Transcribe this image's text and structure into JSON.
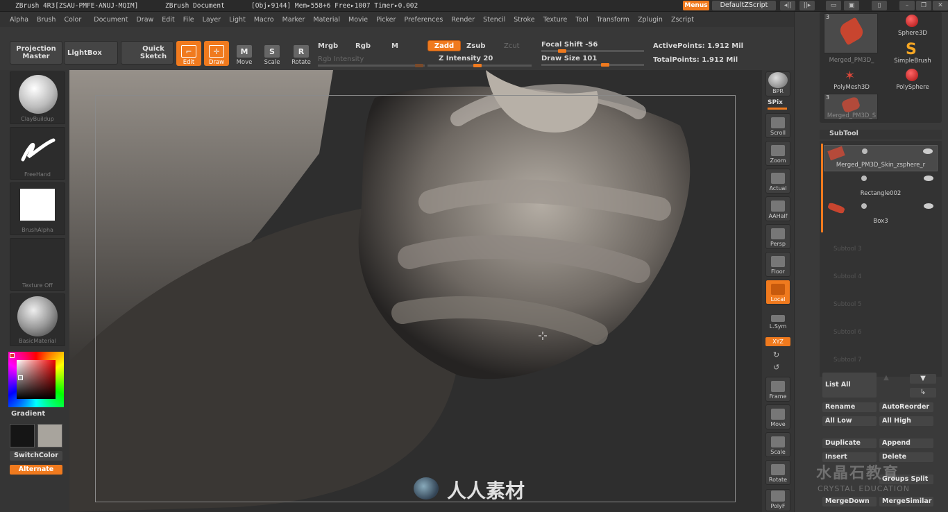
{
  "titlebar": {
    "app": "ZBrush  4R3[ZSAU-PMFE-ANUJ-MQIM]",
    "document": "ZBrush Document",
    "stats": "[Obj▸9144] Mem▸558+6 Free▸1007 Timer▸0.002",
    "menus_label": "Menus",
    "script_label": "DefaultZScript"
  },
  "menubar": {
    "items": [
      "Alpha",
      "Brush",
      "Color",
      "Document",
      "Draw",
      "Edit",
      "File",
      "Layer",
      "Light",
      "Macro",
      "Marker",
      "Material",
      "Movie",
      "Picker",
      "Preferences",
      "Render",
      "Stencil",
      "Stroke",
      "Texture",
      "Tool",
      "Transform",
      "Zplugin",
      "Zscript"
    ]
  },
  "toolbar": {
    "projection_master": "Projection Master",
    "lightbox": "LightBox",
    "quick_sketch": "Quick Sketch",
    "edit": "Edit",
    "draw": "Draw",
    "move": "Move",
    "scale": "Scale",
    "rotate": "Rotate",
    "mrgb": "Mrgb",
    "rgb": "Rgb",
    "m": "M",
    "rgb_intensity": "Rgb Intensity",
    "zadd": "Zadd",
    "zsub": "Zsub",
    "zcut": "Zcut",
    "z_intensity": "Z Intensity 20",
    "focal_shift": "Focal Shift -56",
    "draw_size": "Draw Size 101",
    "active_points": "ActivePoints: 1.912 Mil",
    "total_points": "TotalPoints: 1.912 Mil"
  },
  "leftshelf": {
    "brush": "ClayBuildup",
    "stroke": "FreeHand",
    "alpha": "BrushAlpha",
    "texture": "Texture  Off",
    "material": "BasicMaterial",
    "gradient": "Gradient",
    "switch_color": "SwitchColor",
    "alternate": "Alternate"
  },
  "rightshelf": {
    "buttons": [
      "BPR",
      "SPix",
      "Scroll",
      "Zoom",
      "Actual",
      "AAHalf",
      "Persp",
      "Floor",
      "Local",
      "L.Sym",
      "XYZ",
      "Frame",
      "Move",
      "Scale",
      "Rotate",
      "PolyF"
    ]
  },
  "toolpanel": {
    "thumb1_label": "Merged_PM3D_",
    "sphere3d": "Sphere3D",
    "simplebrush": "SimpleBrush",
    "polymesh3d": "PolyMesh3D",
    "polysphere": "PolySphere",
    "thumb2_label": "Merged_PM3D_S",
    "count1": "3",
    "count2": "3"
  },
  "subtool": {
    "title": "SubTool",
    "items": [
      "Merged_PM3D_Skin_zsphere_r",
      "Rectangle002",
      "Box3"
    ],
    "empty": [
      "Subtool 3",
      "Subtool 4",
      "Subtool 5",
      "Subtool 6",
      "Subtool 7"
    ],
    "list_all": "List  All",
    "rename": "Rename",
    "autoreorder": "AutoReorder",
    "all_low": "All  Low",
    "all_high": "All  High",
    "duplicate": "Duplicate",
    "append": "Append",
    "insert": "Insert",
    "delete": "Delete",
    "groups_split": "Groups Split",
    "mergedown": "MergeDown",
    "mergesimilar": "MergeSimilar"
  },
  "watermark": {
    "cn": "人人素材",
    "cn2": "水晶石教育",
    "en2": "CRYSTAL EDUCATION"
  },
  "colors": {
    "accent": "#f07a1e",
    "panel": "#383838",
    "canvas": "#2e2e2e"
  }
}
